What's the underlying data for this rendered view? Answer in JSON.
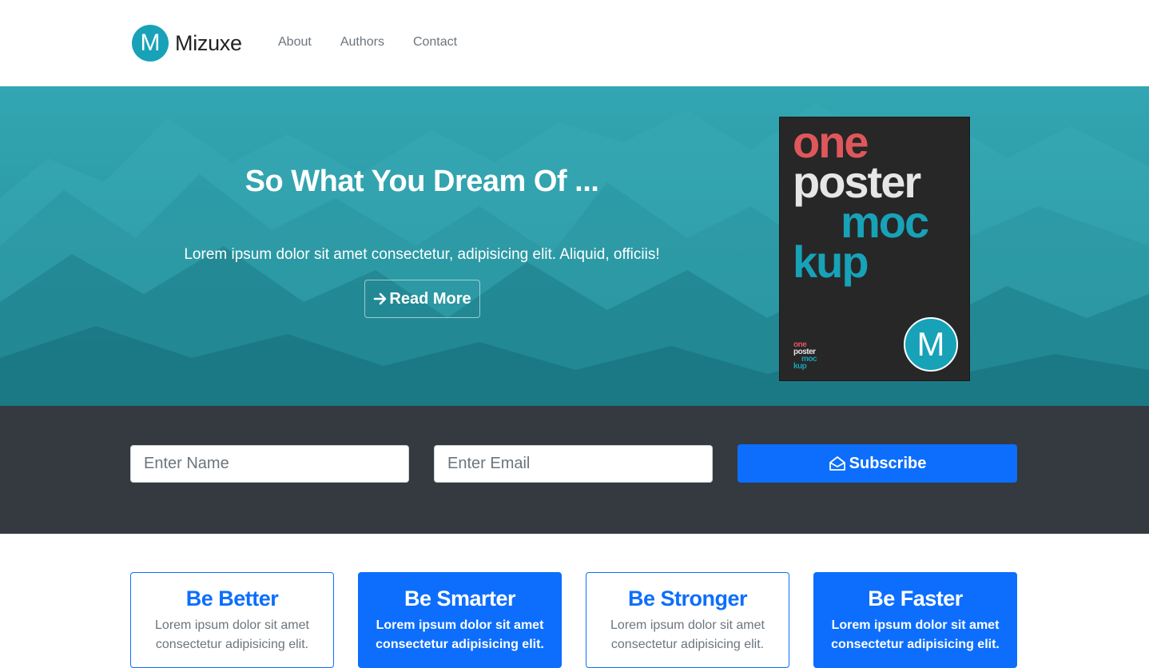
{
  "brand": {
    "logo_letter": "M",
    "name": "Mizuxe"
  },
  "nav": {
    "items": [
      {
        "label": "About"
      },
      {
        "label": "Authors"
      },
      {
        "label": "Contact"
      }
    ]
  },
  "hero": {
    "title": "So What You Dream Of ...",
    "text": "Lorem ipsum dolor sit amet consectetur, adipisicing elit. Aliquid, officiis!",
    "button_label": "Read More",
    "button_icon": "arrow-right-icon",
    "poster": {
      "lines": [
        "one",
        "poster",
        "moc",
        "kup"
      ],
      "small_lines": [
        "one",
        "poster",
        "moc",
        "kup"
      ],
      "logo_letter": "M"
    }
  },
  "subscribe": {
    "name_placeholder": "Enter Name",
    "email_placeholder": "Enter Email",
    "button_label": "Subscribe",
    "button_icon": "envelope-open-icon"
  },
  "cards": [
    {
      "title": "Be Better",
      "text": "Lorem ipsum dolor sit amet consectetur adipisicing elit.",
      "style": "outline"
    },
    {
      "title": "Be Smarter",
      "text": "Lorem ipsum dolor sit amet consectetur adipisicing elit.",
      "style": "filled"
    },
    {
      "title": "Be Stronger",
      "text": "Lorem ipsum dolor sit amet consectetur adipisicing elit.",
      "style": "outline"
    },
    {
      "title": "Be Faster",
      "text": "Lorem ipsum dolor sit amet consectetur adipisicing elit.",
      "style": "filled"
    }
  ],
  "colors": {
    "primary": "#0d6efd",
    "teal": "#17a2b8",
    "dark": "#343a40",
    "poster_red": "#e0575b"
  }
}
